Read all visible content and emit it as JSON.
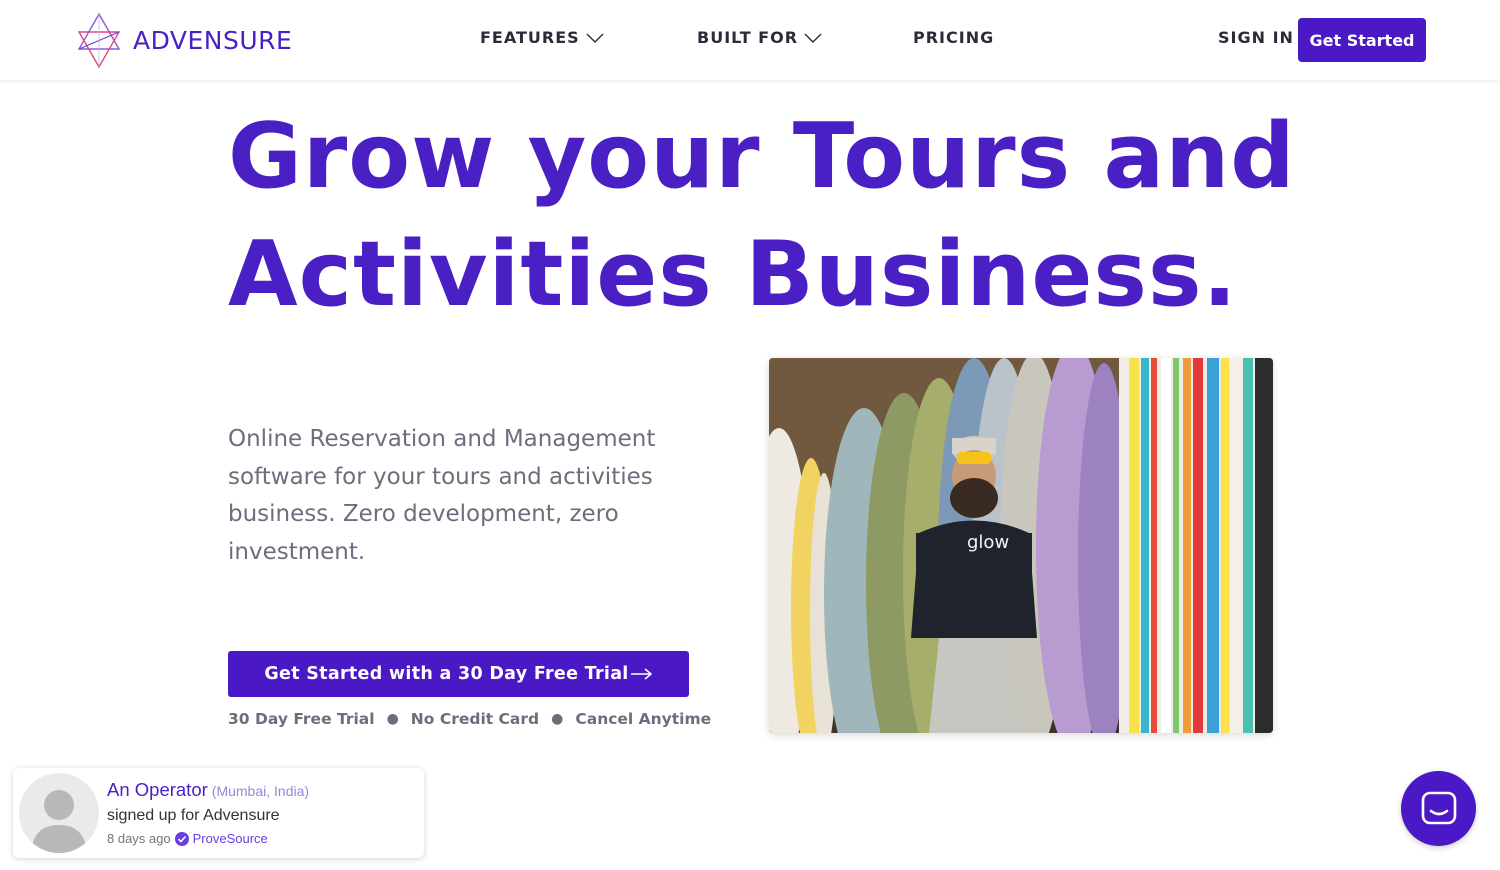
{
  "brand": {
    "name": "ADVENSURE",
    "accent": "#4a18c4"
  },
  "nav": {
    "features": "FEATURES",
    "built_for": "BUILT FOR",
    "pricing": "PRICING",
    "sign_in": "SIGN IN",
    "get_started": "Get Started"
  },
  "hero": {
    "headline_line1": "Grow your Tours and",
    "headline_line2": "Activities Business.",
    "subtext": "Online Reservation and Management software for your tours and activities business. Zero development, zero investment.",
    "cta_label": "Get Started with a 30 Day Free Trial",
    "perks": [
      "30 Day Free Trial",
      "No Credit Card",
      "Cancel Anytime"
    ],
    "photo_shirt_text": "glow"
  },
  "notification": {
    "name": "An Operator",
    "location": "(Mumbai, India)",
    "action": "signed up for Advensure",
    "time": "8 days ago",
    "source": "ProveSource"
  },
  "icons": {
    "logo": "triangle-logo-icon",
    "dropdown": "chevron-down-icon",
    "cta_arrow": "arrow-right-icon",
    "verified": "verified-check-icon",
    "chat": "chat-icon"
  }
}
